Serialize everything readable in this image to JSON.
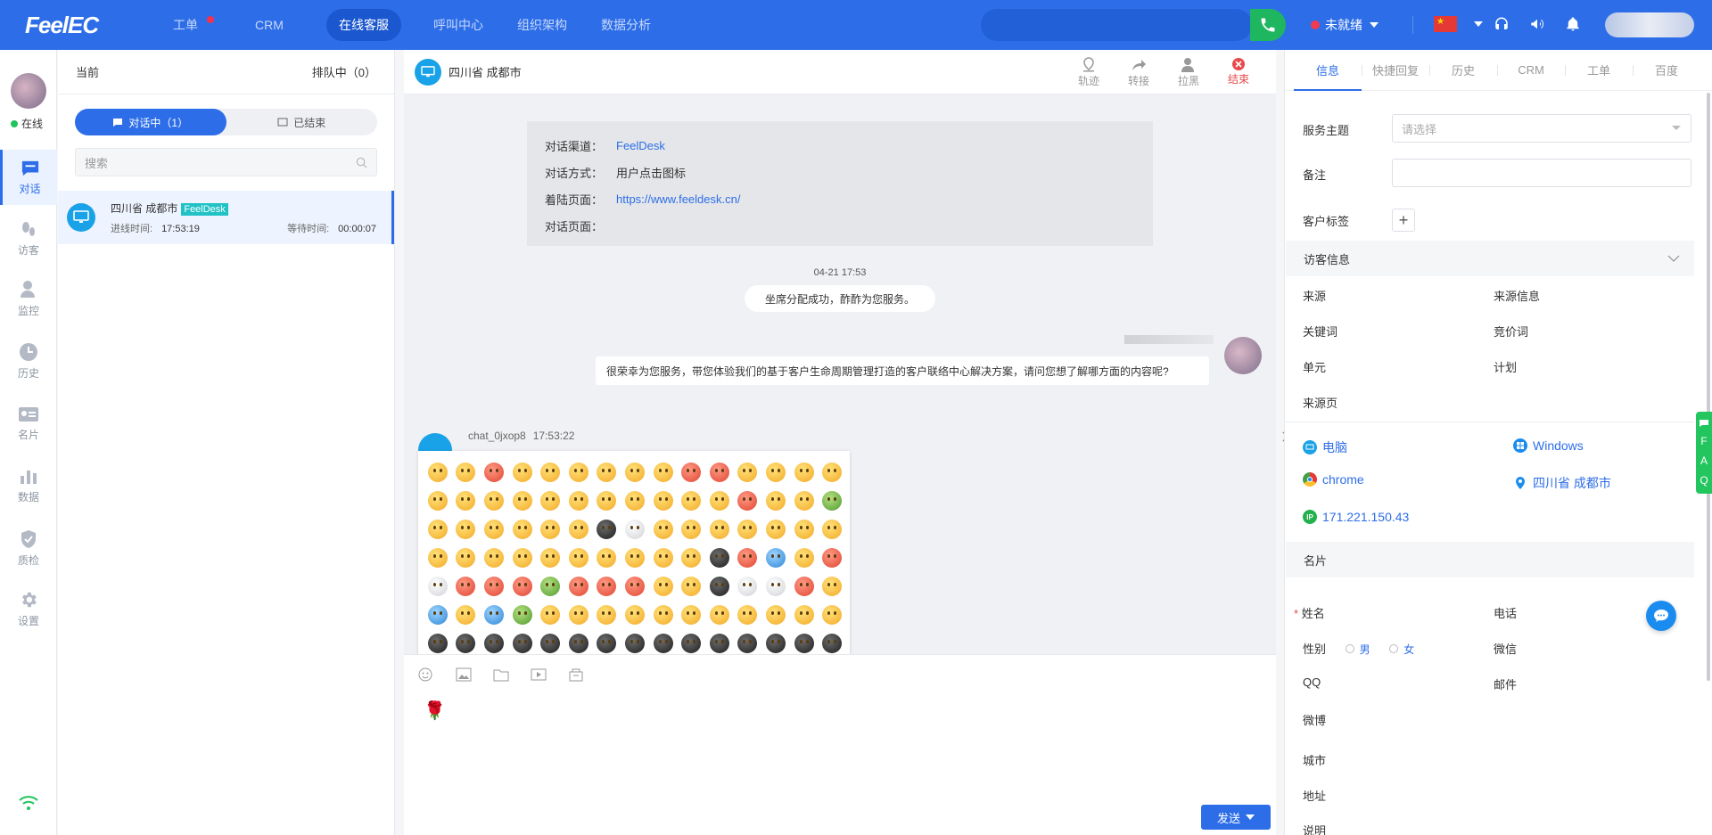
{
  "topbar": {
    "logo": "FeelEC",
    "nav": [
      "工单",
      "CRM",
      "在线客服",
      "呼叫中心",
      "组织架构",
      "数据分析"
    ],
    "active_nav": "在线客服",
    "status": "未就绪"
  },
  "rail": {
    "status": "在线",
    "items": [
      {
        "label": "对话",
        "icon": "chat-icon"
      },
      {
        "label": "访客",
        "icon": "footprint-icon"
      },
      {
        "label": "监控",
        "icon": "monitor-user-icon"
      },
      {
        "label": "历史",
        "icon": "clock-icon"
      },
      {
        "label": "名片",
        "icon": "card-icon"
      },
      {
        "label": "数据",
        "icon": "bar-chart-icon"
      },
      {
        "label": "质检",
        "icon": "shield-icon"
      },
      {
        "label": "设置",
        "icon": "gear-icon"
      }
    ]
  },
  "conversation_list": {
    "header_left": "当前",
    "header_right": "排队中（0）",
    "tab_active": "对话中（1）",
    "tab_ended": "已结束",
    "search_placeholder": "搜索",
    "item": {
      "location": "四川省 成都市",
      "badge": "FeelDesk",
      "enter_label": "进线时间:",
      "enter_time": "17:53:19",
      "wait_label": "等待时间:",
      "wait_time": "00:00:07"
    }
  },
  "chat": {
    "title": "四川省 成都市",
    "actions": [
      "轨迹",
      "转接",
      "拉黑",
      "结束"
    ],
    "info_card": [
      {
        "key": "对话渠道：",
        "value": "FeelDesk"
      },
      {
        "key": "对话方式：",
        "value": "用户点击图标"
      },
      {
        "key": "着陆页面：",
        "value": "https://www.feeldesk.cn/"
      },
      {
        "key": "对话页面：",
        "value": ""
      }
    ],
    "timestamp": "04-21 17:53",
    "system_message": "坐席分配成功，酢酢为您服务。",
    "agent_message": "很荣幸为您服务，带您体验我们的基于客户生命周期管理打造的客户联络中心解决方案，请问您想了解哪方面的内容呢?",
    "visitor_name": "chat_0jxop8",
    "visitor_time": "17:53:22",
    "send_label": "发送"
  },
  "right_panel": {
    "tabs": [
      "信息",
      "快捷回复",
      "历史",
      "CRM",
      "工单",
      "百度"
    ],
    "service_topic_label": "服务主题",
    "service_topic_placeholder": "请选择",
    "note_label": "备注",
    "tags_label": "客户标签",
    "visitor_section": "访客信息",
    "visitor_fields": [
      {
        "left": "来源",
        "right": "来源信息"
      },
      {
        "left": "关键词",
        "right": "竞价词"
      },
      {
        "left": "单元",
        "right": "计划"
      },
      {
        "left": "来源页",
        "right": ""
      }
    ],
    "device": "电脑",
    "os": "Windows",
    "browser": "chrome",
    "location": "四川省 成都市",
    "ip": "171.221.150.43",
    "card_section": "名片",
    "card_fields": {
      "name": "姓名",
      "phone": "电话",
      "gender": "性别",
      "male": "男",
      "female": "女",
      "wechat": "微信",
      "qq": "QQ",
      "email": "邮件",
      "weibo": "微博",
      "city": "城市",
      "address": "地址",
      "desc": "说明"
    },
    "faq": [
      "F",
      "A",
      "Q"
    ]
  }
}
